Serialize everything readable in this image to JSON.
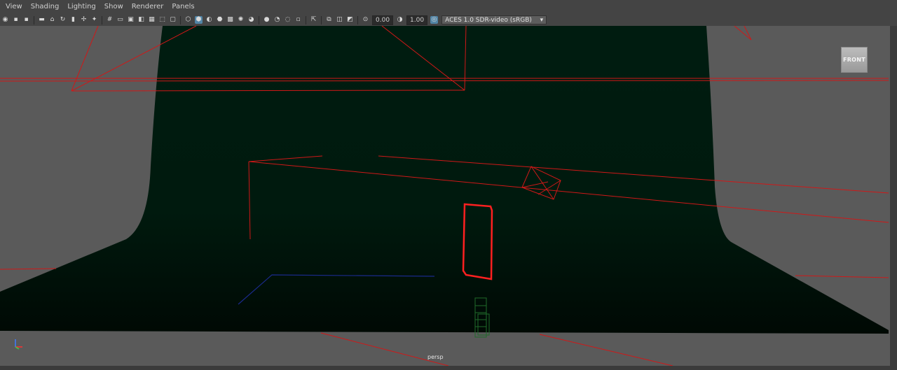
{
  "menubar": {
    "items": [
      {
        "label": "View"
      },
      {
        "label": "Shading"
      },
      {
        "label": "Lighting"
      },
      {
        "label": "Show"
      },
      {
        "label": "Renderer"
      },
      {
        "label": "Panels"
      }
    ]
  },
  "toolbar": {
    "exposure_value": "0.00",
    "gamma_value": "1.00",
    "color_space": "ACES 1.0 SDR-video (sRGB)",
    "icons": [
      "select-camera-icon",
      "camera-attributes-icon",
      "bookmark-icon",
      "image-plane-icon",
      "grid-icon",
      "film-gate-icon",
      "resolution-gate-icon",
      "gate-mask-icon",
      "field-chart-icon",
      "safe-action-icon",
      "wireframe-icon",
      "smooth-shade-icon",
      "default-material-icon",
      "xray-icon",
      "lights-icon",
      "shadows-icon",
      "ambient-occlusion-icon",
      "motion-blur-icon",
      "antialias-icon",
      "depth-of-field-icon",
      "isolate-select-icon",
      "xray-joints-icon",
      "xray-active-icon",
      "exposure-icon",
      "gamma-icon",
      "color-management-icon"
    ]
  },
  "viewport": {
    "camera_name": "persp",
    "viewcube_label": "FRONT",
    "colors": {
      "background": "#5a5a5a",
      "backdrop": "#001c10",
      "curves": "#d01818",
      "selected": "#ff2020",
      "blue_curve": "#1a2a8a",
      "green_obj": "#1f6b2a"
    }
  }
}
